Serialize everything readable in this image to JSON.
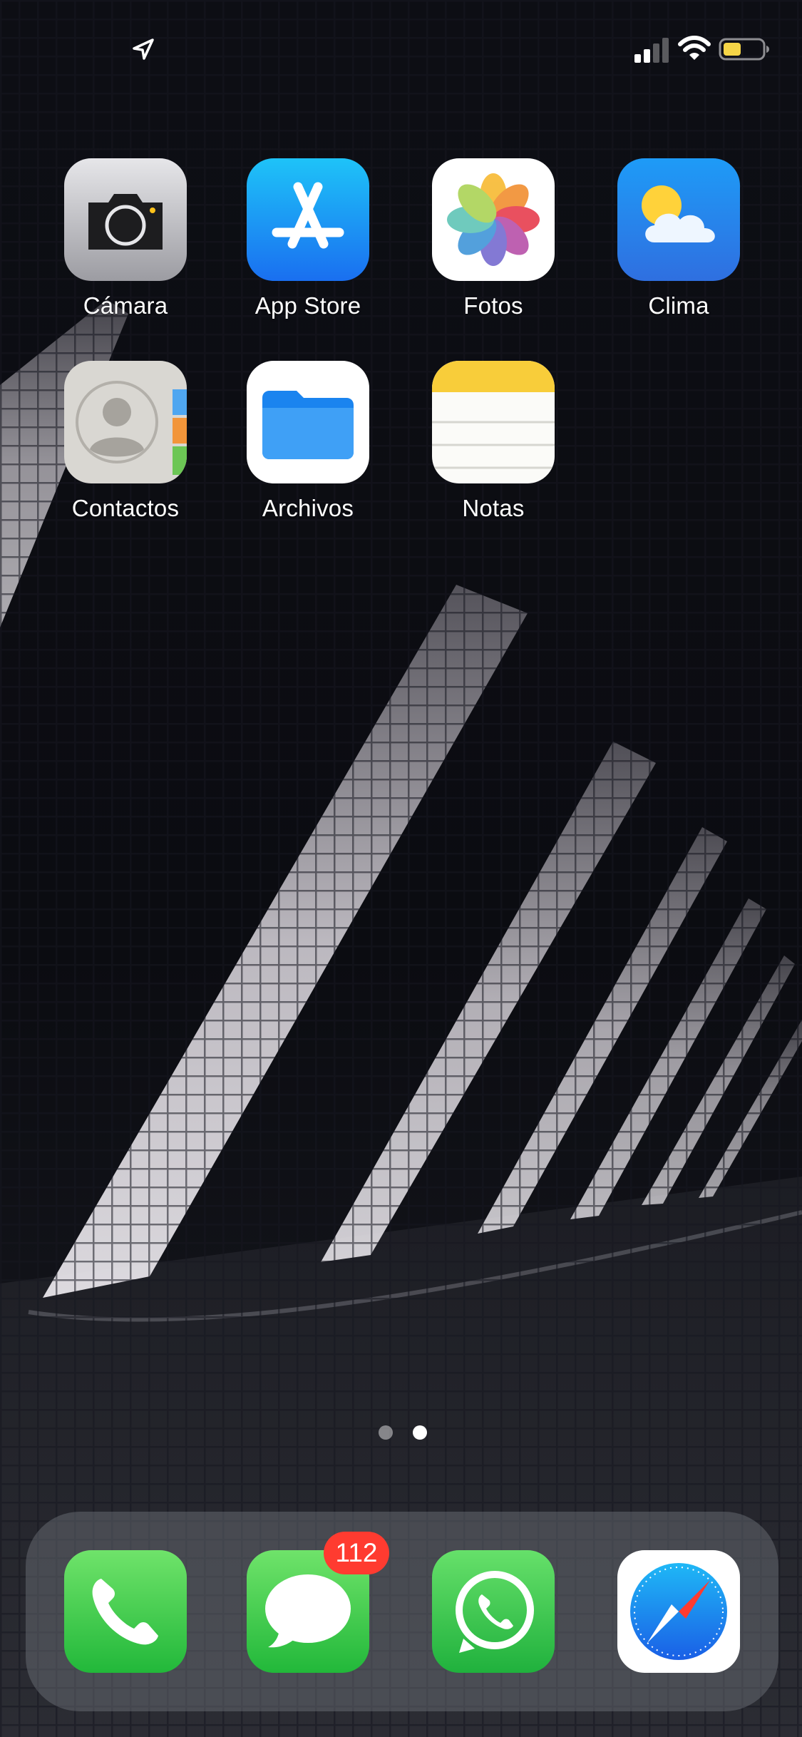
{
  "status_bar": {
    "icons": [
      "location-arrow-icon",
      "cellular-signal-icon",
      "wifi-icon",
      "battery-icon"
    ],
    "battery_color": "#f5d547"
  },
  "home": {
    "apps": [
      {
        "label": "Cámara",
        "icon": "camera-icon"
      },
      {
        "label": "App Store",
        "icon": "app-store-icon"
      },
      {
        "label": "Fotos",
        "icon": "photos-icon"
      },
      {
        "label": "Clima",
        "icon": "weather-icon"
      },
      {
        "label": "Contactos",
        "icon": "contacts-icon"
      },
      {
        "label": "Archivos",
        "icon": "files-icon"
      },
      {
        "label": "Notas",
        "icon": "notes-icon"
      }
    ]
  },
  "page_indicator": {
    "pages": 2,
    "current": 2
  },
  "dock": {
    "apps": [
      {
        "icon": "phone-icon"
      },
      {
        "icon": "messages-icon",
        "badge": "112"
      },
      {
        "icon": "whatsapp-icon"
      },
      {
        "icon": "safari-icon"
      }
    ]
  },
  "colors": {
    "badge": "#ff3b30",
    "ios_green": "#35c759",
    "ios_blue": "#1a8cff"
  }
}
